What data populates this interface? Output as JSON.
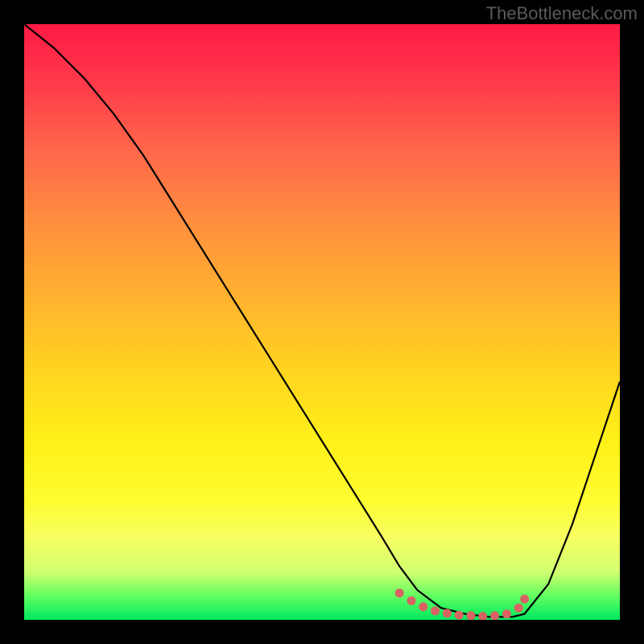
{
  "watermark": "TheBottleneck.com",
  "colors": {
    "background": "#000000",
    "curve": "#000000",
    "marker": "#d96262",
    "watermark_text": "#5a5a5a"
  },
  "chart_data": {
    "type": "line",
    "title": "",
    "xlabel": "",
    "ylabel": "",
    "xlim": [
      0,
      100
    ],
    "ylim": [
      0,
      100
    ],
    "grid": false,
    "series": [
      {
        "name": "bottleneck-curve",
        "x": [
          0,
          5,
          10,
          15,
          20,
          25,
          30,
          35,
          40,
          45,
          50,
          55,
          60,
          63,
          66,
          70,
          74,
          78,
          82,
          84,
          88,
          92,
          96,
          100
        ],
        "y": [
          100,
          96,
          91,
          85,
          78,
          70,
          62,
          54,
          46,
          38,
          30,
          22,
          14,
          9,
          5,
          2,
          1,
          0.5,
          0.5,
          1,
          6,
          16,
          28,
          40
        ]
      }
    ],
    "markers": {
      "name": "minimum-region-scatter",
      "x": [
        63,
        65,
        67,
        69,
        71,
        73,
        75,
        77,
        79,
        81,
        83,
        84
      ],
      "y": [
        4.5,
        3.2,
        2.2,
        1.5,
        1.1,
        0.8,
        0.7,
        0.6,
        0.7,
        1.0,
        2.0,
        3.5
      ]
    }
  }
}
